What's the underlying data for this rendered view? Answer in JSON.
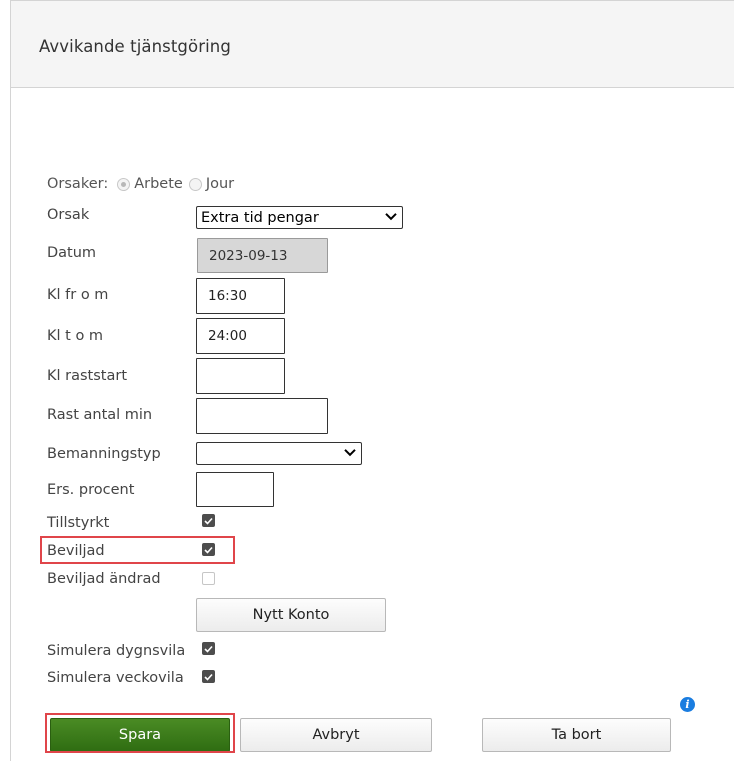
{
  "panel": {
    "title": "Avvikande tjänstgöring"
  },
  "orsaker": {
    "label": "Orsaker:",
    "options": [
      {
        "label": "Arbete",
        "checked": true
      },
      {
        "label": "Jour",
        "checked": false
      }
    ]
  },
  "fields": {
    "orsak": {
      "label": "Orsak",
      "value": "Extra tid pengar"
    },
    "datum": {
      "label": "Datum",
      "value": "2023-09-13"
    },
    "kl_from": {
      "label": "Kl fr o m",
      "value": "16:30"
    },
    "kl_tom": {
      "label": "Kl t o m",
      "value": "24:00"
    },
    "kl_raststart": {
      "label": "Kl raststart",
      "value": ""
    },
    "rast_antal_min": {
      "label": "Rast antal min",
      "value": ""
    },
    "bemanningstyp": {
      "label": "Bemanningstyp",
      "value": ""
    },
    "ers_procent": {
      "label": "Ers. procent",
      "value": ""
    }
  },
  "checkboxes": {
    "tillstyrkt": {
      "label": "Tillstyrkt",
      "checked": true
    },
    "beviljad": {
      "label": "Beviljad",
      "checked": true
    },
    "beviljad_andrad": {
      "label": "Beviljad ändrad",
      "checked": false,
      "disabled": true
    },
    "simulera_dygnsvila": {
      "label": "Simulera dygnsvila",
      "checked": true
    },
    "simulera_veckovila": {
      "label": "Simulera veckovila",
      "checked": true
    }
  },
  "buttons": {
    "nytt_konto": "Nytt Konto",
    "spara": "Spara",
    "avbryt": "Avbryt",
    "ta_bort": "Ta bort"
  },
  "icons": {
    "info": "info-icon",
    "chevron": "chevron-down-icon",
    "check": "check-icon"
  },
  "colors": {
    "primary_button": "#3a7b1b",
    "highlight": "#e0454a",
    "info": "#1a7de0"
  }
}
